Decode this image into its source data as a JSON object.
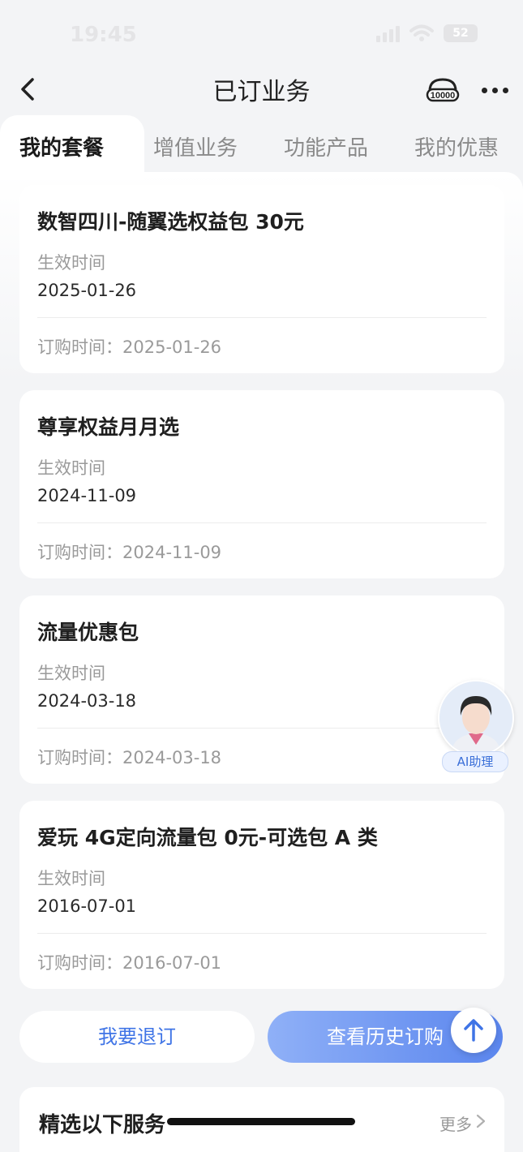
{
  "status_bar": {
    "time": "19:45",
    "battery": "52"
  },
  "nav": {
    "title": "已订业务",
    "service_icon": "10000-customer-service-icon",
    "more_icon": "more-dots-icon"
  },
  "tabs": [
    {
      "label": "我的套餐",
      "active": true
    },
    {
      "label": "增值业务",
      "active": false
    },
    {
      "label": "功能产品",
      "active": false
    },
    {
      "label": "我的优惠",
      "active": false
    }
  ],
  "cards": [
    {
      "title": "数智四川-随翼选权益包 30元",
      "effective_label": "生效时间",
      "effective_date": "2025-01-26",
      "order_text": "订购时间：2025-01-26"
    },
    {
      "title": "尊享权益月月选",
      "effective_label": "生效时间",
      "effective_date": "2024-11-09",
      "order_text": "订购时间：2024-11-09"
    },
    {
      "title": "流量优惠包",
      "effective_label": "生效时间",
      "effective_date": "2024-03-18",
      "order_text": "订购时间：2024-03-18"
    },
    {
      "title": "爱玩 4G定向流量包 0元-可选包 A 类",
      "effective_label": "生效时间",
      "effective_date": "2016-07-01",
      "order_text": "订购时间：2016-07-01"
    }
  ],
  "ai_assistant": {
    "label": "AI助理"
  },
  "actions": {
    "unsubscribe": "我要退订",
    "history": "查看历史订购"
  },
  "recommend": {
    "title": "精选以下服务",
    "more": "更多"
  },
  "colors": {
    "accent": "#3f74e6",
    "gradient_start": "#8fb0f7",
    "gradient_end": "#5b86ee"
  }
}
